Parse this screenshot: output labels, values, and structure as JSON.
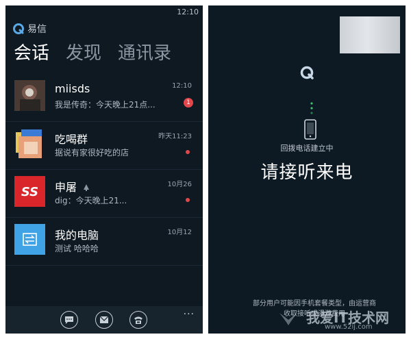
{
  "left_screen": {
    "clock": "12:10",
    "app_name": "易信",
    "tabs": [
      {
        "label": "会话",
        "active": true
      },
      {
        "label": "发现",
        "active": false
      },
      {
        "label": "通讯录",
        "active": false
      }
    ],
    "conversations": [
      {
        "name": "miisds",
        "preview": "我是传奇：今天晚上21点...",
        "time": "12:10",
        "unread_count": "1",
        "avatar": "photo-avatar"
      },
      {
        "name": "吃喝群",
        "preview": "据说有家很好吃的店",
        "time": "昨天11:23",
        "unread_dot": true,
        "avatar": "group-avatar"
      },
      {
        "name": "申屠",
        "preview": "dig：今天晚上21...",
        "time": "10月26",
        "unread_dot": true,
        "avatar": "ss-logo-avatar"
      },
      {
        "name": "我的电脑",
        "preview": "测试 哈哈哈",
        "time": "10月12",
        "avatar": "transfer-avatar"
      }
    ],
    "bottom_bar": {
      "buttons": [
        "chat-bubble-icon",
        "mail-icon",
        "phone-icon"
      ],
      "more": "..."
    }
  },
  "right_screen": {
    "status": "回拨电话建立中",
    "headline": "请接听来电",
    "notice_line1": "部分用户可能因手机套餐类型，由运营商",
    "notice_line2": "收取接听或漫游费用",
    "watermark": "我爱IT技术网",
    "watermark_url": "www.52ij.com"
  },
  "colors": {
    "background": "#0f1922",
    "accent_blue": "#2f9fe0",
    "unread_red": "#e2474b",
    "connecting_green": "#3ebf6a"
  }
}
